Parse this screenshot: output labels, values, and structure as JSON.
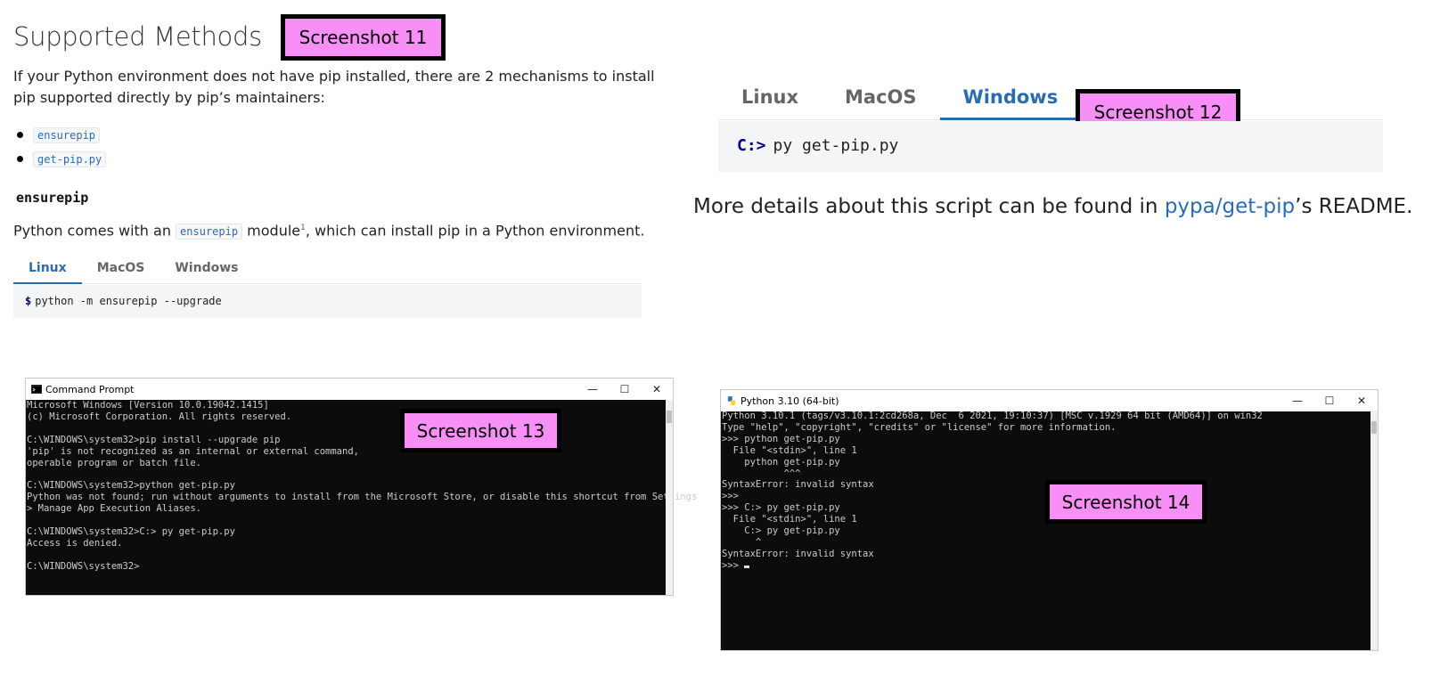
{
  "panel11": {
    "label": "Screenshot 11",
    "title": "Supported Methods",
    "intro": "If your Python environment does not have pip installed, there are 2 mechanisms to install pip supported directly by pip’s maintainers:",
    "methods": [
      "ensurepip",
      "get-pip.py"
    ],
    "section_heading": "ensurepip",
    "para_before": "Python comes with an ",
    "para_code": "ensurepip",
    "para_module": " module",
    "para_footnote": "1",
    "para_after": ", which can install pip in a Python environment.",
    "tabs": [
      "Linux",
      "MacOS",
      "Windows"
    ],
    "active_tab": "Linux",
    "code_prompt": "$",
    "code_command": "python -m ensurepip --upgrade"
  },
  "panel12": {
    "label": "Screenshot 12",
    "tabs": [
      "Linux",
      "MacOS",
      "Windows"
    ],
    "active_tab": "Windows",
    "code_prompt": "C:>",
    "code_command": "py get-pip.py",
    "para_before": "More details about this script can be found in ",
    "para_link": "pypa/get-pip",
    "para_after": "’s README."
  },
  "panel13": {
    "label": "Screenshot 13",
    "window_title": "Command Prompt",
    "lines": [
      "Microsoft Windows [Version 10.0.19042.1415]",
      "(c) Microsoft Corporation. All rights reserved.",
      "",
      "C:\\WINDOWS\\system32>pip install --upgrade pip",
      "'pip' is not recognized as an internal or external command,",
      "operable program or batch file.",
      "",
      "C:\\WINDOWS\\system32>python get-pip.py",
      "Python was not found; run without arguments to install from the Microsoft Store, or disable this shortcut from Settings",
      "> Manage App Execution Aliases.",
      "",
      "C:\\WINDOWS\\system32>C:> py get-pip.py",
      "Access is denied.",
      "",
      "C:\\WINDOWS\\system32>"
    ]
  },
  "panel14": {
    "label": "Screenshot 14",
    "window_title": "Python 3.10 (64-bit)",
    "lines": [
      "Python 3.10.1 (tags/v3.10.1:2cd268a, Dec  6 2021, 19:10:37) [MSC v.1929 64 bit (AMD64)] on win32",
      "Type \"help\", \"copyright\", \"credits\" or \"license\" for more information.",
      ">>> python get-pip.py",
      "  File \"<stdin>\", line 1",
      "    python get-pip.py",
      "           ^^^",
      "SyntaxError: invalid syntax",
      ">>>",
      ">>> C:> py get-pip.py",
      "  File \"<stdin>\", line 1",
      "    C:> py get-pip.py",
      "      ^",
      "SyntaxError: invalid syntax",
      ">>> "
    ]
  },
  "window_controls": {
    "minimize": "—",
    "maximize": "☐",
    "close": "✕"
  },
  "colors": {
    "label_bg": "#f78ff7",
    "link": "#2b6cb0",
    "terminal_bg": "#0c0c0c"
  }
}
